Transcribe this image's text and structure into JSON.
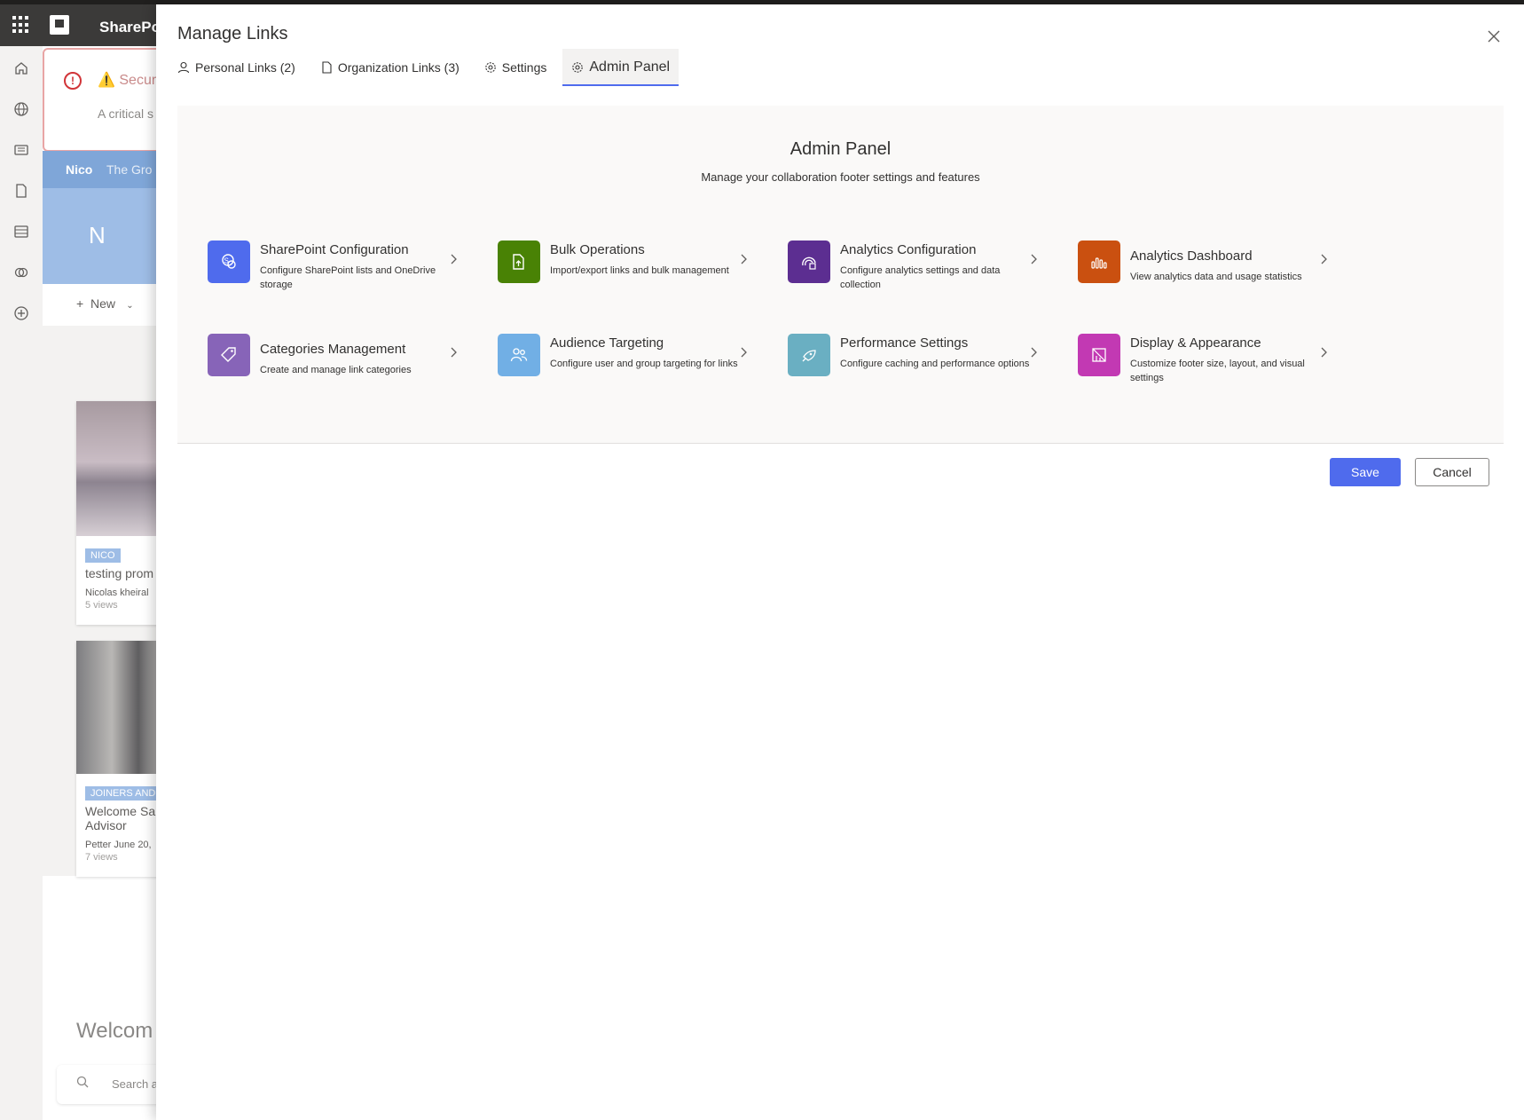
{
  "app": {
    "brand": "SharePoi"
  },
  "background": {
    "alert_title": "⚠️ Securi",
    "alert_text": "A critical s",
    "nav_items": [
      "Nico",
      "The Gro"
    ],
    "hero_initial": "N",
    "new_label": "New",
    "cards": [
      {
        "tag": "NICO",
        "title": "testing prom",
        "author": "Nicolas kheiral",
        "views": "5 views"
      },
      {
        "tag": "JOINERS AND",
        "title": "Welcome Sa",
        "title2": "Advisor",
        "author": "Petter  June 20,",
        "views": "7 views"
      }
    ],
    "welcome": "Welcom",
    "search_placeholder": "Search a"
  },
  "modal": {
    "title": "Manage Links",
    "tabs": [
      {
        "label": "Personal Links (2)",
        "icon": "person-icon",
        "active": false
      },
      {
        "label": "Organization Links (3)",
        "icon": "document-icon",
        "active": false
      },
      {
        "label": "Settings",
        "icon": "gear-icon",
        "active": false
      },
      {
        "label": "Admin Panel",
        "icon": "gear-icon",
        "active": true
      }
    ],
    "admin_panel": {
      "title": "Admin Panel",
      "subtitle": "Manage your collaboration footer settings and features",
      "features": [
        {
          "title": "SharePoint Configuration",
          "desc": "Configure SharePoint lists and OneDrive storage",
          "icon": "sharepoint-icon",
          "color": "#4f6bed"
        },
        {
          "title": "Bulk Operations",
          "desc": "Import/export links and bulk management",
          "icon": "document-upload-icon",
          "color": "#498205"
        },
        {
          "title": "Analytics Configuration",
          "desc": "Configure analytics settings and data collection",
          "icon": "data-settings-icon",
          "color": "#5c2e91"
        },
        {
          "title": "Analytics Dashboard",
          "desc": "View analytics data and usage statistics",
          "icon": "bar-chart-icon",
          "color": "#ca5010"
        },
        {
          "title": "Categories Management",
          "desc": "Create and manage link categories",
          "icon": "tag-icon",
          "color": "#8764b8"
        },
        {
          "title": "Audience Targeting",
          "desc": "Configure user and group targeting for links",
          "icon": "people-icon",
          "color": "#71afe5"
        },
        {
          "title": "Performance Settings",
          "desc": "Configure caching and performance options",
          "icon": "rocket-icon",
          "color": "#6aafc2"
        },
        {
          "title": "Display & Appearance",
          "desc": "Customize footer size, layout, and visual settings",
          "icon": "design-icon",
          "color": "#c239b3"
        }
      ]
    },
    "save_label": "Save",
    "cancel_label": "Cancel"
  }
}
